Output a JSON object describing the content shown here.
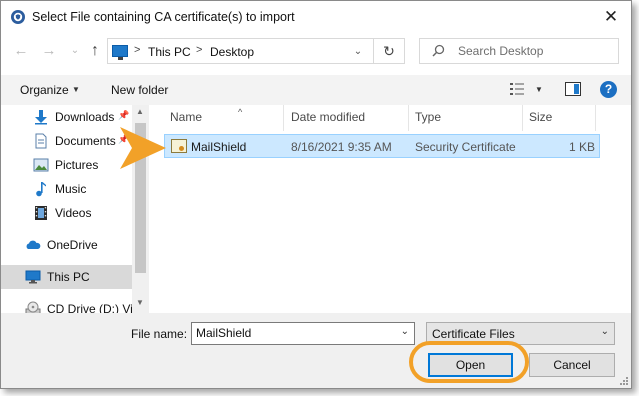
{
  "window": {
    "title": "Select File containing CA certificate(s) to import",
    "close_glyph": "✕"
  },
  "address_bar": {
    "breadcrumbs": [
      "This PC",
      "Desktop"
    ],
    "separator": ">",
    "dropdown_glyph": "⌄",
    "refresh_glyph": "↻"
  },
  "search": {
    "placeholder": "Search Desktop",
    "icon": "search-icon"
  },
  "nav_buttons": {
    "back_glyph": "←",
    "forward_glyph": "→",
    "recent_glyph": "⌄",
    "up_glyph": "↑"
  },
  "toolbar": {
    "organize_label": "Organize",
    "organize_arrow": "▼",
    "new_folder_label": "New folder",
    "view_arrow": "▼",
    "help_label": "?"
  },
  "sidebar": {
    "items": [
      {
        "label": "Downloads",
        "icon": "download-arrow-icon",
        "pinned": true
      },
      {
        "label": "Documents",
        "icon": "documents-icon",
        "pinned": true
      },
      {
        "label": "Pictures",
        "icon": "pictures-icon",
        "pinned": false
      },
      {
        "label": "Music",
        "icon": "music-note-icon",
        "pinned": false
      },
      {
        "label": "Videos",
        "icon": "videos-film-icon",
        "pinned": false
      },
      {
        "label": "OneDrive",
        "icon": "cloud-icon",
        "pinned": false
      },
      {
        "label": "This PC",
        "icon": "computer-icon",
        "pinned": false,
        "selected": true
      },
      {
        "label": "CD Drive (D:) Vir",
        "icon": "cd-drive-icon",
        "pinned": false
      }
    ],
    "pin_glyph": "📌"
  },
  "file_list": {
    "columns": [
      "Name",
      "Date modified",
      "Type",
      "Size"
    ],
    "sort_glyph": "^",
    "rows": [
      {
        "name": "MailShield",
        "date_modified": "8/16/2021 9:35 AM",
        "type": "Security Certificate",
        "size": "1 KB",
        "selected": true
      }
    ]
  },
  "bottom": {
    "file_name_label": "File name:",
    "file_name_value": "MailShield",
    "file_type_value": "Certificate Files",
    "dropdown_glyph": "⌄",
    "open_label": "Open",
    "cancel_label": "Cancel"
  },
  "colors": {
    "accent": "#0078d7",
    "selection_bg": "#cce8ff",
    "highlight_orange": "#f2a128"
  }
}
